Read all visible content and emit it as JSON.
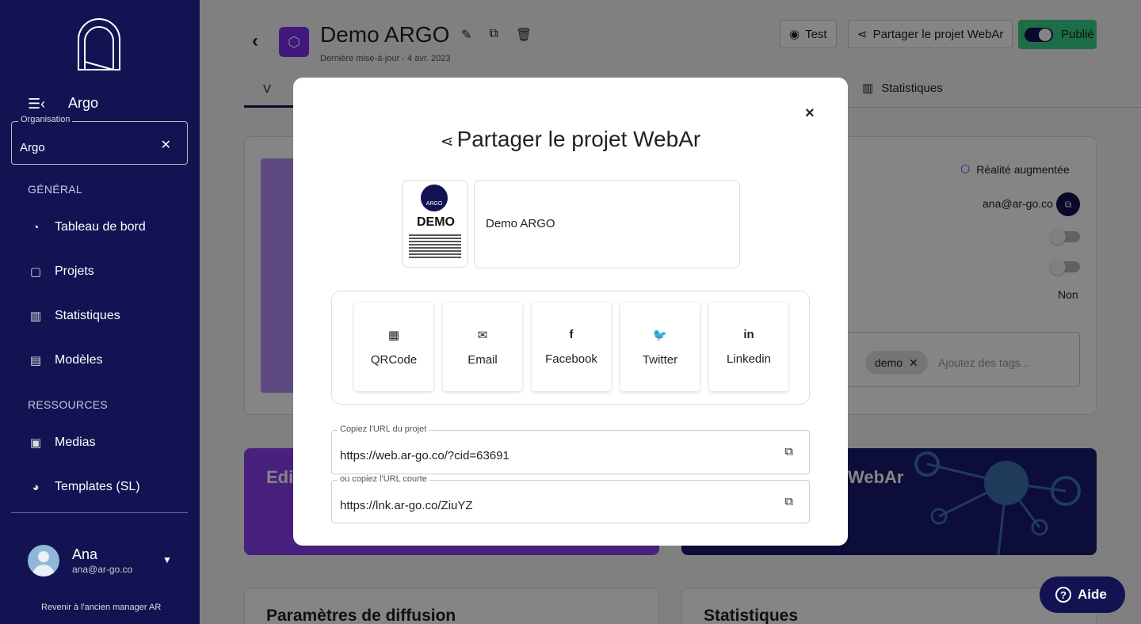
{
  "sidebar": {
    "org_header": "Argo",
    "org_field": {
      "label": "Organisation",
      "value": "Argo"
    },
    "section_general": "GÉNÉRAL",
    "section_resources": "RESSOURCES",
    "items": [
      {
        "label": "Tableau de bord",
        "icon": "dashboard-icon"
      },
      {
        "label": "Projets",
        "icon": "file-icon"
      },
      {
        "label": "Statistiques",
        "icon": "bar-chart-icon"
      },
      {
        "label": "Modèles",
        "icon": "book-icon"
      },
      {
        "label": "Medias",
        "icon": "photos-icon"
      },
      {
        "label": "Templates (SL)",
        "icon": "palette-icon"
      }
    ],
    "user": {
      "name": "Ana",
      "email": "ana@ar-go.co"
    },
    "old_manager": "Revenir à l'ancien manager AR"
  },
  "header": {
    "title": "Demo ARGO",
    "last_update": "Dernière mise-à-jour - 4 avr. 2023",
    "test_label": "Test",
    "share_label": "Partager le projet WebAr",
    "publish_label": "Publié",
    "tab_active_label": "V",
    "tab_stats_label": "Statistiques"
  },
  "details": {
    "ar_label": "Réalité augmentée",
    "owner_email": "ana@ar-go.co",
    "non_label": "Non",
    "tag": "demo",
    "tags_placeholder": "Ajoutez des tags..."
  },
  "cards": {
    "editor_title": "Edit",
    "webar_title": "WebAr",
    "diffusion_title": "Paramètres de diffusion",
    "stats_title": "Statistiques"
  },
  "modal": {
    "title": "Partager le projet WebAr",
    "close": "×",
    "thumbnail": {
      "logo_text": "ARGO",
      "heading": "DEMO"
    },
    "project_name": "Demo ARGO",
    "share_options": [
      {
        "label": "QRCode",
        "icon": "qrcode-icon",
        "glyph": "▦"
      },
      {
        "label": "Email",
        "icon": "envelope-icon",
        "glyph": "✉"
      },
      {
        "label": "Facebook",
        "icon": "facebook-icon",
        "glyph": "f"
      },
      {
        "label": "Twitter",
        "icon": "twitter-icon",
        "glyph": "🐦"
      },
      {
        "label": "Linkedin",
        "icon": "linkedin-icon",
        "glyph": "in"
      }
    ],
    "url_field": {
      "label": "Copiez l'URL du projet",
      "value": "https://web.ar-go.co/?cid=63691"
    },
    "short_url_field": {
      "label": "ou copiez l'URL courte",
      "value": "https://lnk.ar-go.co/ZiuYZ"
    }
  },
  "help": {
    "label": "Aide"
  },
  "colors": {
    "sidebar": "#131353",
    "accent_purple": "#7b2ff2",
    "publish_green": "#38d48b"
  }
}
